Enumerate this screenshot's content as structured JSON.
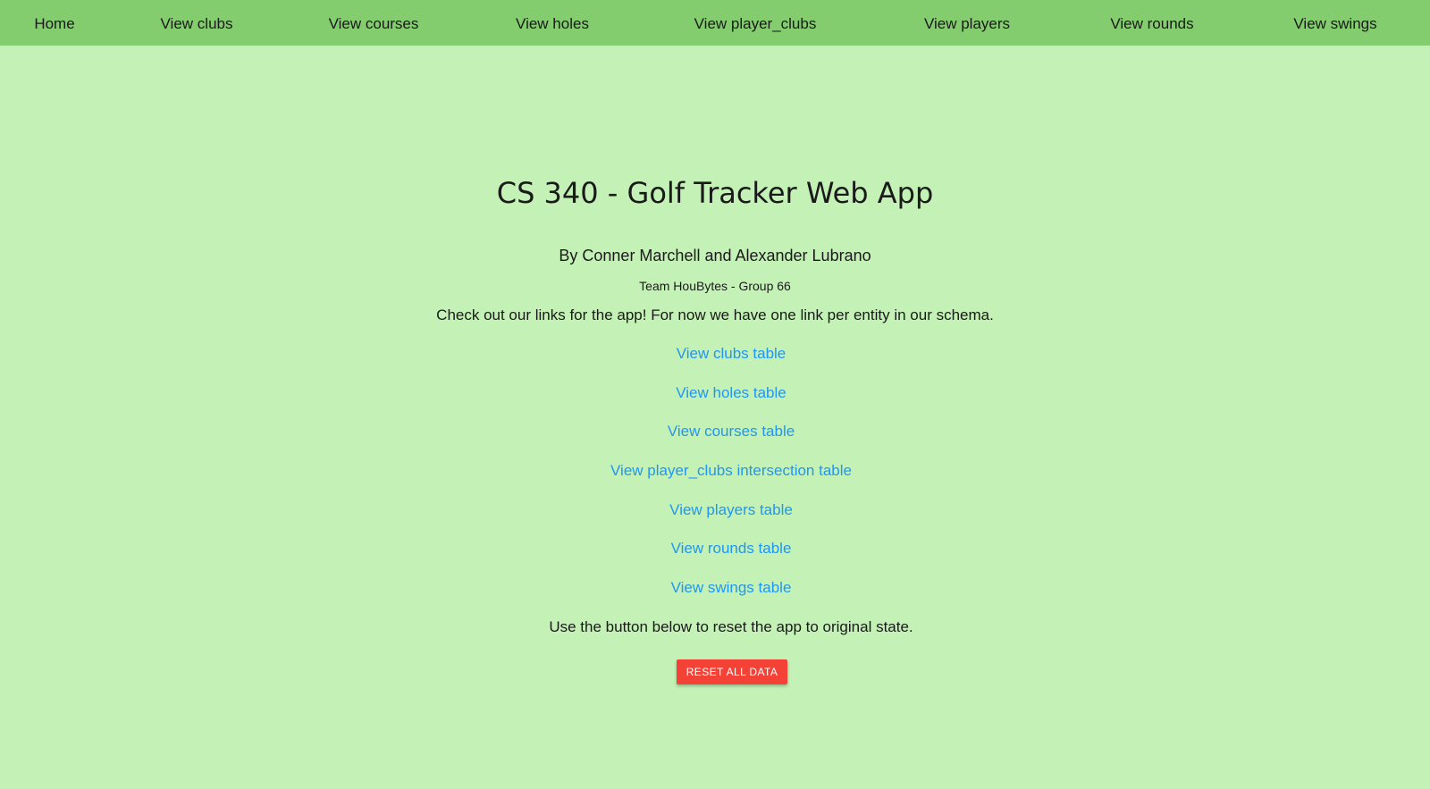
{
  "nav": {
    "items": [
      {
        "label": "Home"
      },
      {
        "label": "View clubs"
      },
      {
        "label": "View courses"
      },
      {
        "label": "View holes"
      },
      {
        "label": "View player_clubs"
      },
      {
        "label": "View players"
      },
      {
        "label": "View rounds"
      },
      {
        "label": "View swings"
      }
    ]
  },
  "page": {
    "title": "CS 340 - Golf Tracker Web App",
    "authors": "By Conner Marchell and Alexander Lubrano",
    "team": "Team HouBytes - Group 66",
    "intro": "Check out our links for the app! For now we have one link per entity in our schema.",
    "links": [
      {
        "label": "View clubs table"
      },
      {
        "label": "View holes table"
      },
      {
        "label": "View courses table"
      },
      {
        "label": "View player_clubs intersection table"
      },
      {
        "label": "View players table"
      },
      {
        "label": "View rounds table"
      },
      {
        "label": "View swings table"
      }
    ],
    "reset_text": "Use the button below to reset the app to original state.",
    "reset_button": "RESET ALL DATA"
  },
  "colors": {
    "background": "#c4f1b6",
    "navbar": "#83cd6e",
    "link": "#2196f3",
    "reset_button": "#f44336"
  }
}
